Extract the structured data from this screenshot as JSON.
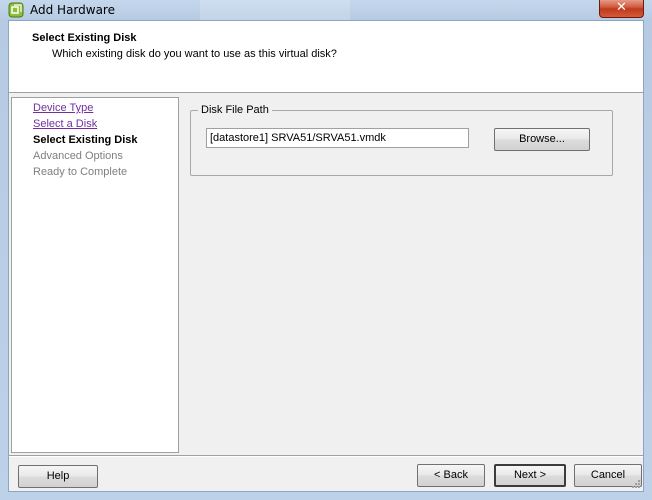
{
  "window": {
    "title": "Add Hardware",
    "close_label": "✕"
  },
  "header": {
    "title": "Select Existing Disk",
    "subtitle": "Which existing disk do you want to use as this virtual disk?"
  },
  "steps": [
    {
      "label": "Device Type",
      "state": "link"
    },
    {
      "label": "Select a Disk",
      "state": "link"
    },
    {
      "label": "Select Existing Disk",
      "state": "current"
    },
    {
      "label": "Advanced Options",
      "state": "future"
    },
    {
      "label": "Ready to Complete",
      "state": "future"
    }
  ],
  "disk_file": {
    "legend": "Disk File Path",
    "value": "[datastore1] SRVA51/SRVA51.vmdk",
    "browse_label": "Browse..."
  },
  "footer": {
    "help_label": "Help",
    "back_label": "< Back",
    "next_label": "Next >",
    "cancel_label": "Cancel"
  },
  "colors": {
    "link": "#7030a0",
    "future": "#7f7f7f",
    "titlebar": "#c4d7ec",
    "close": "#c0391c"
  }
}
